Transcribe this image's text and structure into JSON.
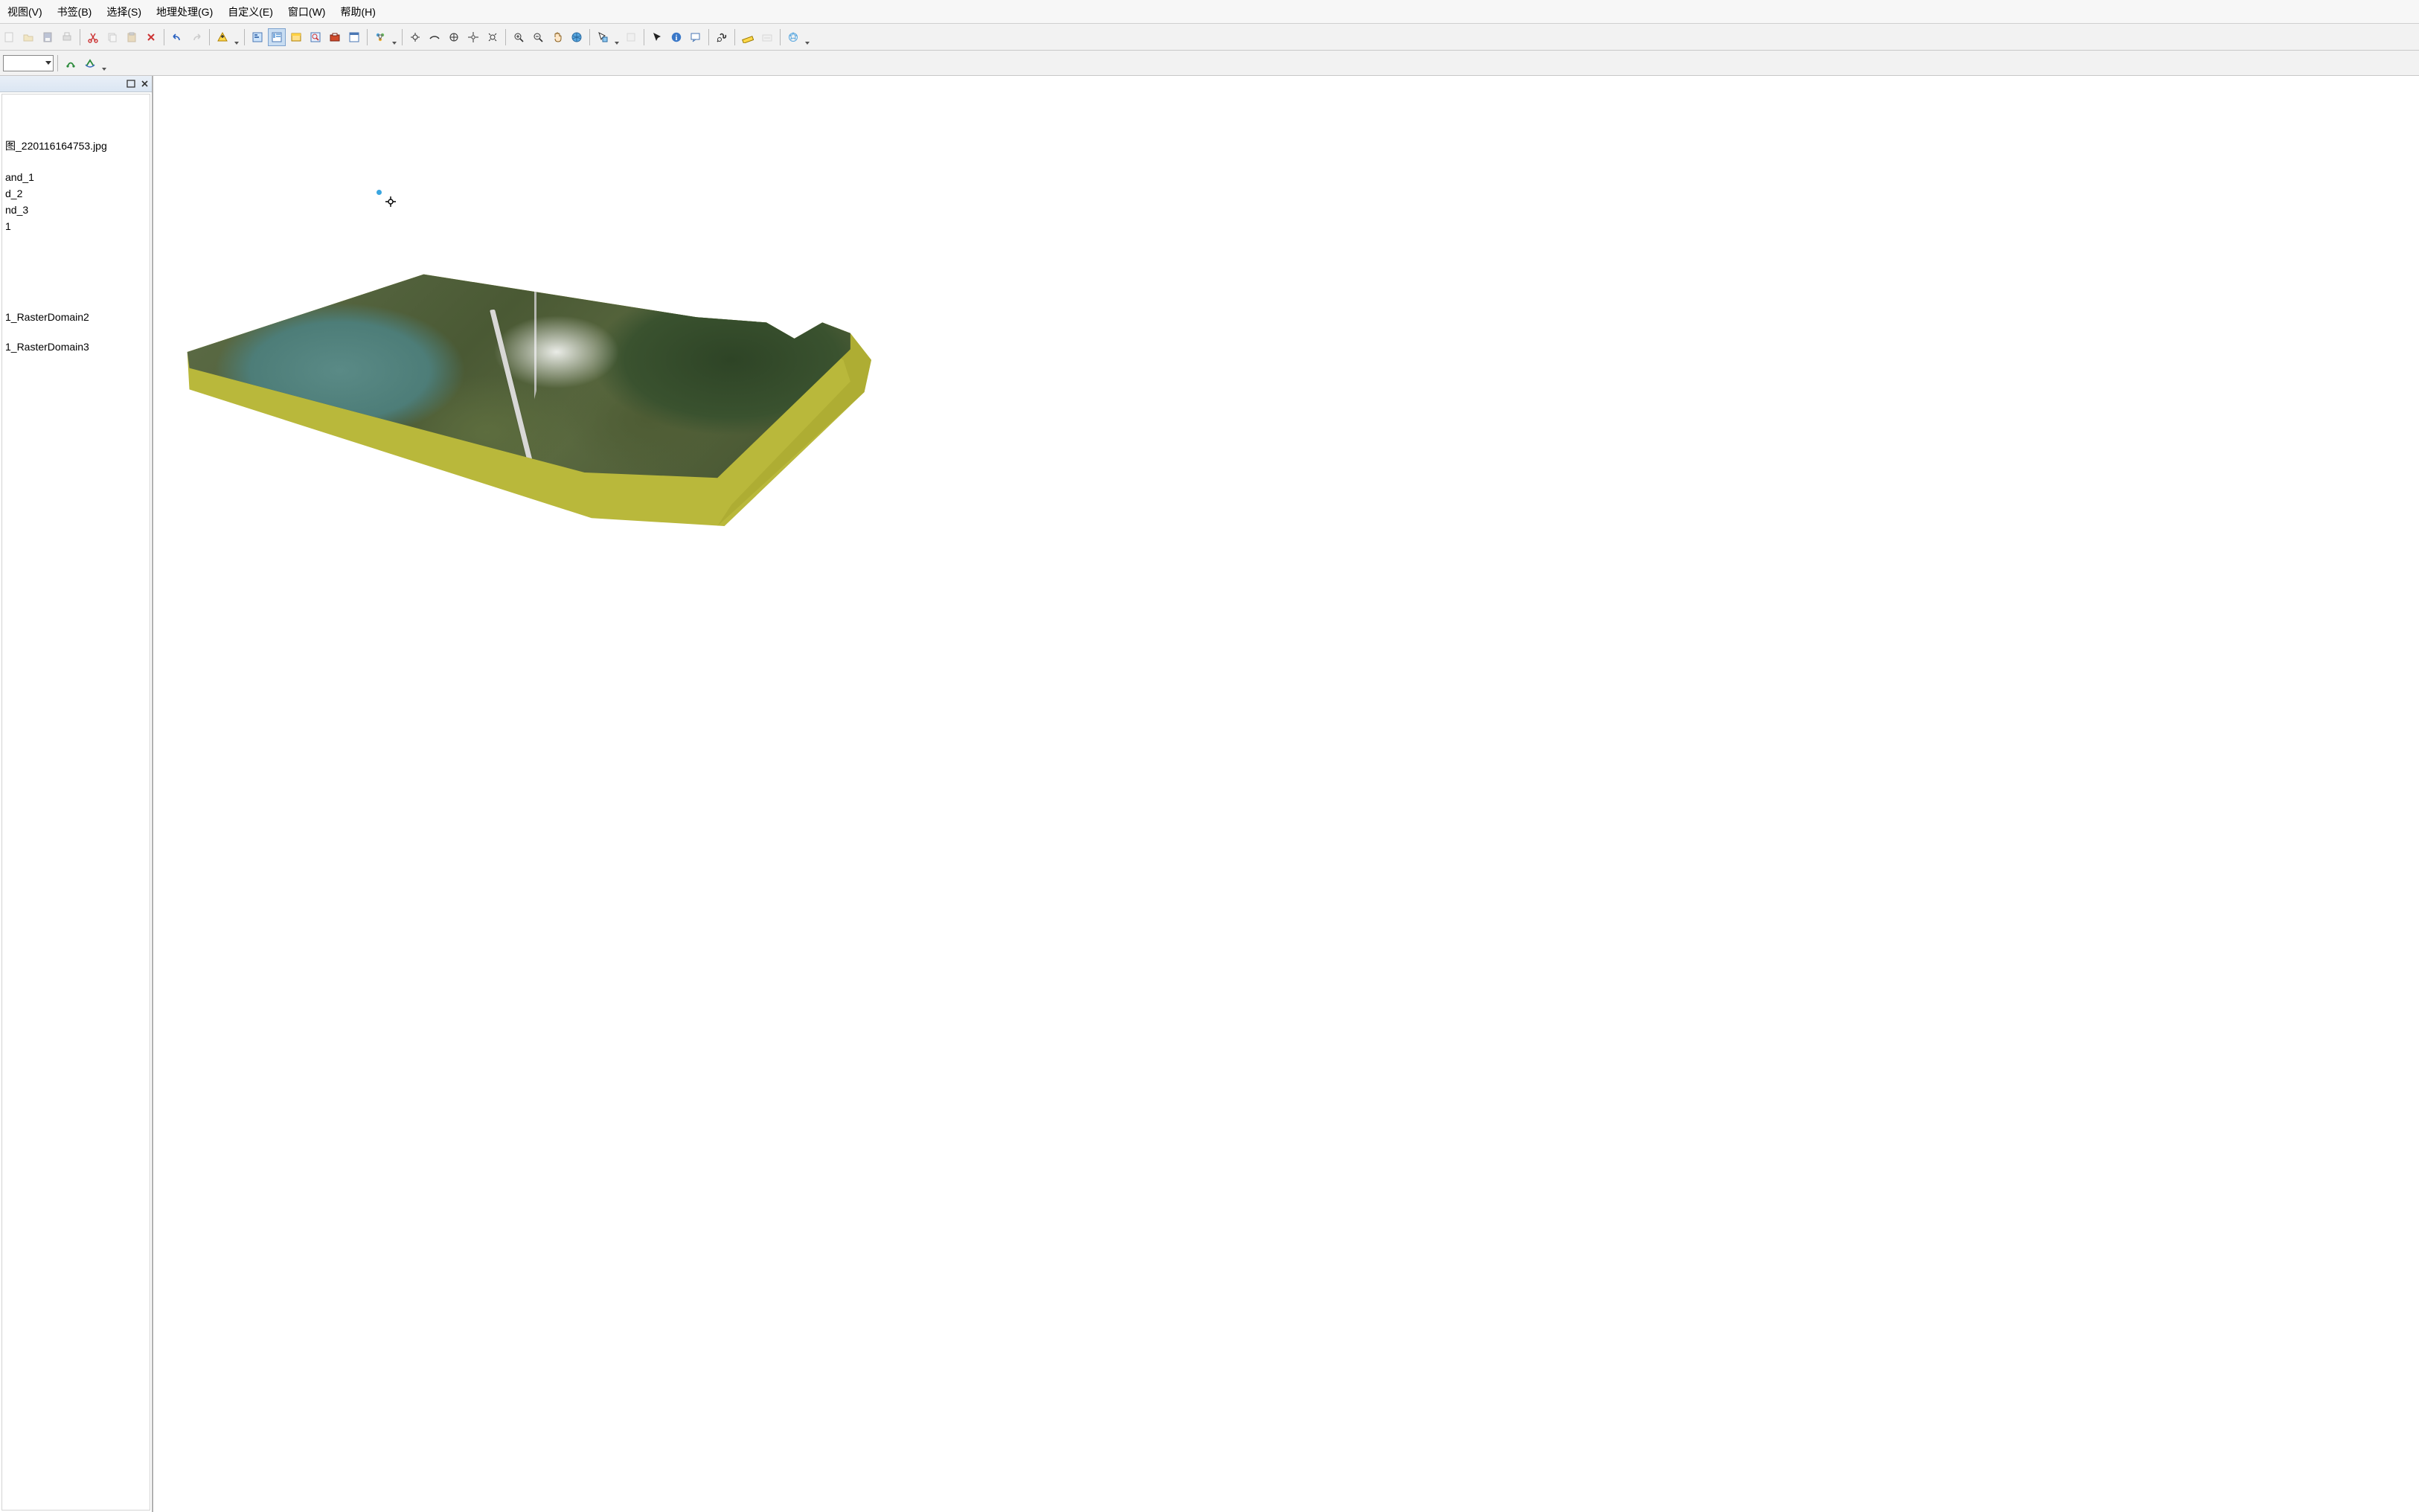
{
  "menu": {
    "view": "视图(V)",
    "bookmarks": "书签(B)",
    "selection": "选择(S)",
    "geoprocessing": "地理处理(G)",
    "customize": "自定义(E)",
    "window": "窗口(W)",
    "help": "帮助(H)"
  },
  "toc": {
    "layer_image": "图_220116164753.jpg",
    "band1": "and_1",
    "band2": "d_2",
    "band3": "nd_3",
    "item_one": "1",
    "raster_domain2": "1_RasterDomain2",
    "raster_domain3": "1_RasterDomain3"
  },
  "icons": {
    "new": "new-icon",
    "open": "open-icon",
    "save": "save-icon",
    "print": "print-icon",
    "cut": "cut-icon",
    "copy": "copy-icon",
    "paste": "paste-icon",
    "delete": "delete-icon",
    "undo": "undo-icon",
    "redo": "redo-icon"
  }
}
